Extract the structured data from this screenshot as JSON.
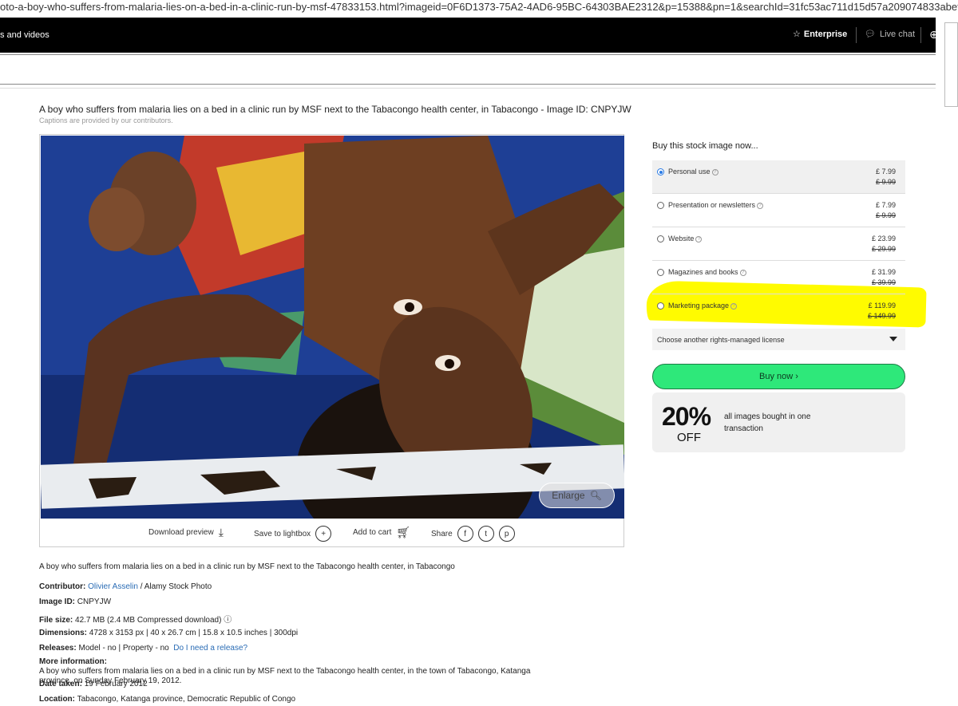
{
  "browser": {
    "url": "oto-a-boy-who-suffers-from-malaria-lies-on-a-bed-in-a-clinic-run-by-msf-47833153.html?imageid=0F6D1373-75A2-4AD6-95BC-64303BAE2312&p=15388&pn=1&searchId=31fc53ac711d15d57a209074833abefc&searcht..."
  },
  "topbar": {
    "nav_left": "s and videos",
    "enterprise": "Enterprise",
    "live_chat": "Live chat"
  },
  "image": {
    "title": "A boy who suffers from malaria lies on a bed in a clinic run by MSF next to the Tabacongo health center, in Tabacongo - Image ID: CNPYJW",
    "caption_note": "Captions are provided by our contributors.",
    "enlarge": "Enlarge",
    "actions": {
      "download_preview": "Download preview",
      "save_to_lightbox": "Save to lightbox",
      "add_to_cart": "Add to cart",
      "share": "Share"
    },
    "description": "A boy who suffers from malaria lies on a bed in a clinic run by MSF next to the Tabacongo health center, in Tabacongo"
  },
  "details": {
    "contributor_label": "Contributor:",
    "contributor_name": "Olivier Asselin",
    "contributor_suffix": " / Alamy Stock Photo",
    "image_id_label": "Image ID:",
    "image_id": "CNPYJW",
    "file_size_label": "File size:",
    "file_size": "42.7 MB (2.4 MB Compressed download)",
    "dimensions_label": "Dimensions:",
    "dimensions": "4728 x 3153 px | 40 x 26.7 cm | 15.8 x 10.5 inches | 300dpi",
    "releases_label": "Releases:",
    "releases": "Model - no | Property - no",
    "release_link": "Do I need a release?",
    "more_info_label": "More information:",
    "more_info": "A boy who suffers from malaria lies on a bed in a clinic run by MSF next to the Tabacongo health center, in the town of Tabacongo, Katanga province, on Sunday February 19, 2012.",
    "date_taken_label": "Date taken:",
    "date_taken": "19 February 2012",
    "location_label": "Location:",
    "location": "Tabacongo, Katanga province, Democratic Republic of Congo"
  },
  "purchase": {
    "title": "Buy this stock image now...",
    "licenses": [
      {
        "name": "Personal use",
        "price": "£ 7.99",
        "old_price": "£ 9.99",
        "selected": true
      },
      {
        "name": "Presentation or newsletters",
        "price": "£ 7.99",
        "old_price": "£ 9.99",
        "selected": false
      },
      {
        "name": "Website",
        "price": "£ 23.99",
        "old_price": "£ 29.99",
        "selected": false
      },
      {
        "name": "Magazines and books",
        "price": "£ 31.99",
        "old_price": "£ 39.99",
        "selected": false
      },
      {
        "name": "Marketing package",
        "price": "£ 119.99",
        "old_price": "£ 149.99",
        "selected": false
      }
    ],
    "choose_other": "Choose another rights-managed license",
    "buy_now": "Buy now ›",
    "promo_percent": "20%",
    "promo_off": "OFF",
    "promo_text": "all images bought in one transaction"
  },
  "colors": {
    "buy_button": "#2ee87a",
    "highlight": "#fffb00",
    "link": "#2a6cb5"
  }
}
